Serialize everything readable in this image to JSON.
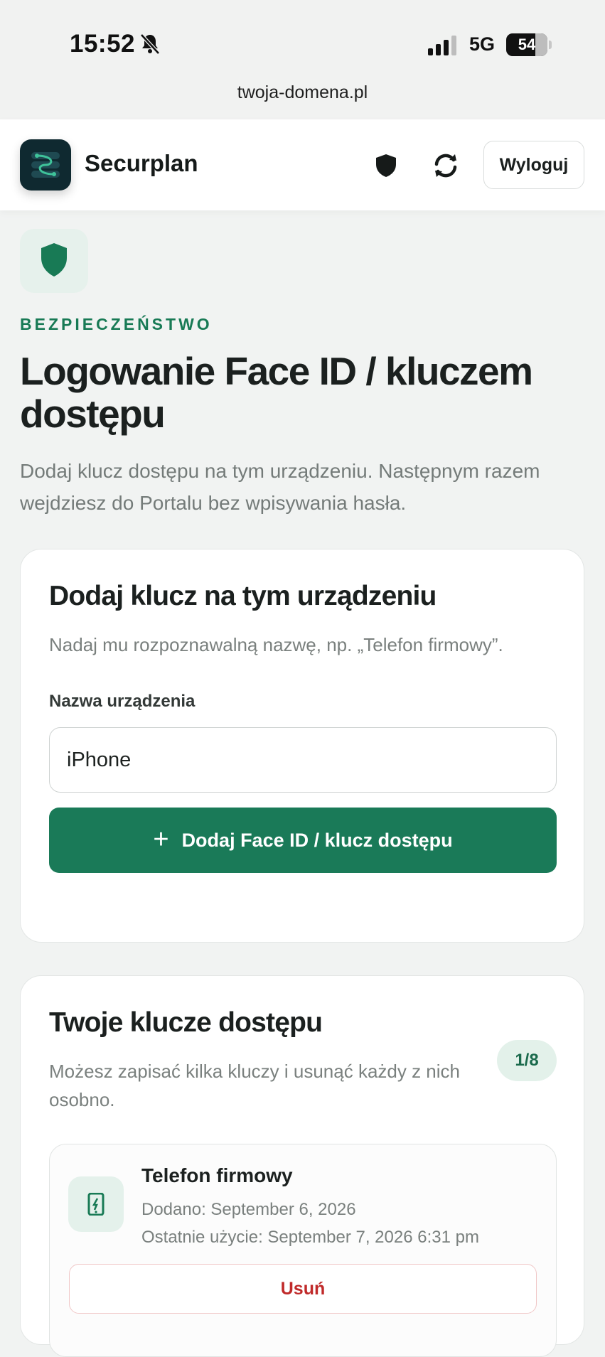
{
  "status_bar": {
    "time": "15:52",
    "network": "5G",
    "battery": "54"
  },
  "browser": {
    "url": "twoja-domena.pl"
  },
  "header": {
    "brand": "Securplan",
    "logout_label": "Wyloguj",
    "icons": [
      "shield-icon",
      "sync-icon"
    ]
  },
  "hero": {
    "eyebrow": "BEZPIECZEŃSTWO",
    "title": "Logowanie Face ID / kluczem dostępu",
    "lead": "Dodaj klucz dostępu na tym urządzeniu. Następnym razem wejdziesz do Portalu bez wpisywania hasła."
  },
  "add_card": {
    "title": "Dodaj klucz na tym urządzeniu",
    "subtitle": "Nadaj mu rozpoznawalną nazwę, np. „Telefon firmowy”.",
    "field_label": "Nazwa urządzenia",
    "field_value": "iPhone",
    "button_label": "Dodaj Face ID / klucz dostępu"
  },
  "keys_card": {
    "title": "Twoje klucze dostępu",
    "subtitle": "Możesz zapisać kilka kluczy i usunąć każdy z nich osobno.",
    "count": "1/8",
    "items": [
      {
        "name": "Telefon firmowy",
        "added": "Dodano: September 6, 2026",
        "last_used": "Ostatnie użycie: September 7, 2026 6:31 pm",
        "delete_label": "Usuń"
      }
    ]
  },
  "colors": {
    "accent": "#1a7a58",
    "accent_light": "#e4f1eb",
    "danger": "#c02a2a",
    "background": "#f1f3f2"
  }
}
